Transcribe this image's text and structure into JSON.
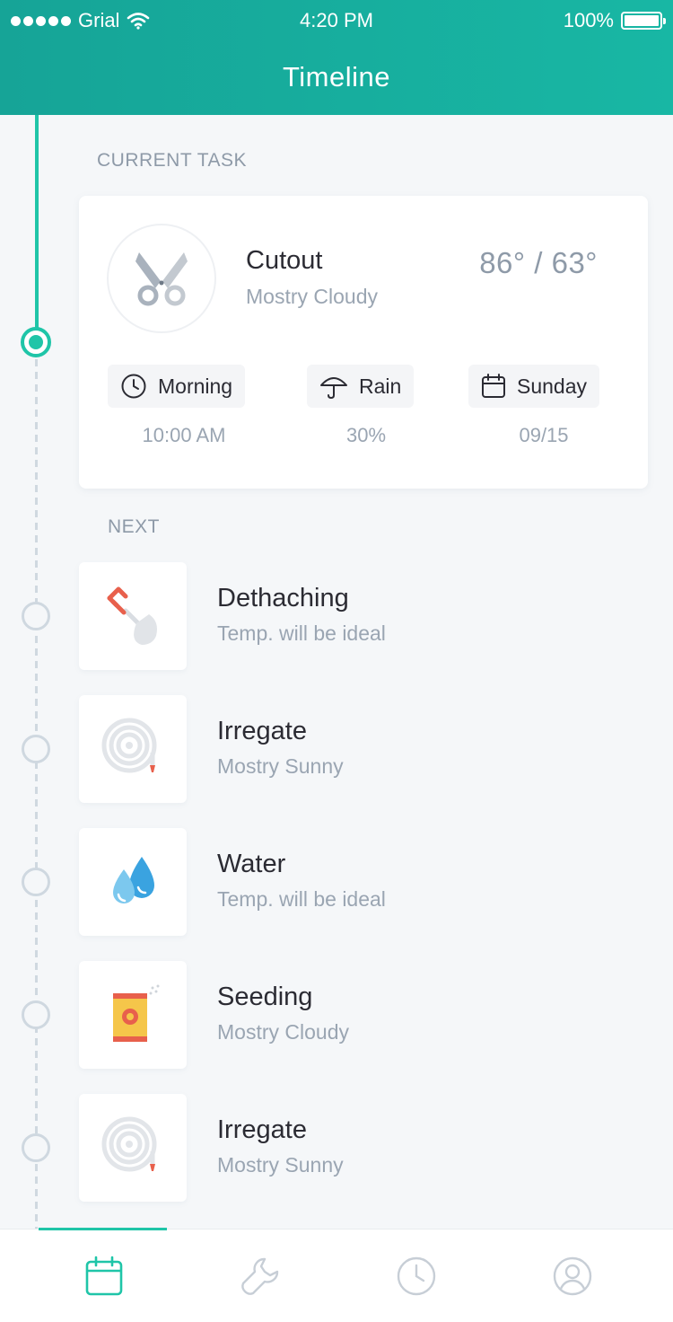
{
  "status_bar": {
    "carrier": "Grial",
    "time": "4:20 PM",
    "battery": "100%"
  },
  "header": {
    "title": "Timeline"
  },
  "current_section": {
    "label": "CURRENT TASK"
  },
  "current_task": {
    "name": "Cutout",
    "condition": "Mostry Cloudy",
    "temperature": "86° / 63°",
    "icon": "scissors-icon",
    "details": [
      {
        "label": "Morning",
        "value": "10:00 AM",
        "icon": "clock-icon"
      },
      {
        "label": "Rain",
        "value": "30%",
        "icon": "umbrella-icon"
      },
      {
        "label": "Sunday",
        "value": "09/15",
        "icon": "calendar-icon"
      }
    ]
  },
  "next_section": {
    "label": "NEXT"
  },
  "next_tasks": [
    {
      "title": "Dethaching",
      "subtitle": "Temp. will be ideal",
      "icon": "shovel-icon"
    },
    {
      "title": "Irregate",
      "subtitle": "Mostry Sunny",
      "icon": "hose-icon"
    },
    {
      "title": "Water",
      "subtitle": "Temp. will be ideal",
      "icon": "water-drops-icon"
    },
    {
      "title": "Seeding",
      "subtitle": "Mostry Cloudy",
      "icon": "seed-bag-icon"
    },
    {
      "title": "Irregate",
      "subtitle": "Mostry Sunny",
      "icon": "hose-icon"
    }
  ],
  "tabbar": {
    "tabs": [
      "calendar-icon",
      "wrench-icon",
      "clock-icon",
      "profile-icon"
    ],
    "active_index": 0
  },
  "colors": {
    "accent": "#1fc5a8",
    "header": "#16a497",
    "muted": "#9aa5b2"
  }
}
